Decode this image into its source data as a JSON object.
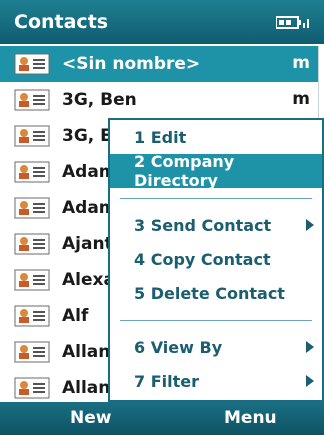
{
  "titlebar": {
    "title": "Contacts",
    "battery_icon": "battery-signal-icon"
  },
  "contacts": [
    {
      "name": "<Sin nombre>",
      "index": "m",
      "selected": true
    },
    {
      "name": "3G, Ben",
      "index": "m"
    },
    {
      "name": "3G, E",
      "index": ""
    },
    {
      "name": "Adam",
      "index": ""
    },
    {
      "name": "Adam",
      "index": ""
    },
    {
      "name": "Ajant",
      "index": ""
    },
    {
      "name": "Alexa",
      "index": ""
    },
    {
      "name": "Alf",
      "index": ""
    },
    {
      "name": "Allan",
      "index": ""
    },
    {
      "name": "Allan",
      "index": ""
    }
  ],
  "menu": {
    "items": [
      {
        "label": "1 Edit"
      },
      {
        "label": "2 Company Directory",
        "highlighted": true
      },
      {
        "label": "3 Send Contact",
        "submenu": true
      },
      {
        "label": "4 Copy Contact"
      },
      {
        "label": "5 Delete Contact"
      },
      {
        "label": "6 View By",
        "submenu": true
      },
      {
        "label": "7 Filter",
        "submenu": true
      }
    ]
  },
  "softkeys": {
    "left": "New",
    "right": "Menu"
  },
  "colors": {
    "accent": "#1e93a8",
    "bar": "#1a6f83",
    "menu_text": "#1b5e70"
  }
}
